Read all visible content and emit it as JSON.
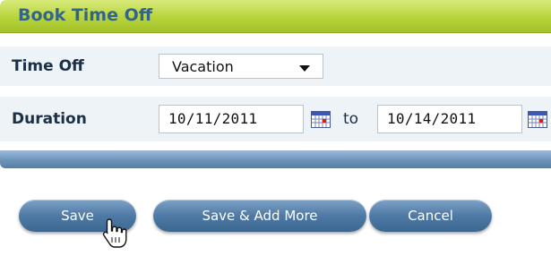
{
  "header": {
    "title": "Book Time Off"
  },
  "form": {
    "time_off": {
      "label": "Time Off",
      "value": "Vacation"
    },
    "duration": {
      "label": "Duration",
      "start_date": "10/11/2011",
      "separator": "to",
      "end_date": "10/14/2011"
    }
  },
  "actions": {
    "save": "Save",
    "save_add_more": "Save & Add More",
    "cancel": "Cancel"
  },
  "colors": {
    "header_green": "#b7d43a",
    "title_blue": "#356489",
    "button_blue": "#4f7aa5"
  },
  "icons": [
    "calendar-icon",
    "calendar-icon",
    "chevron-down-icon",
    "hand-pointer-icon"
  ]
}
